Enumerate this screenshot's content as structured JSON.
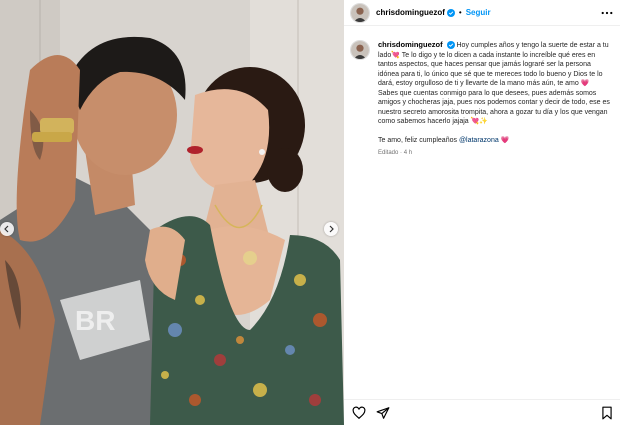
{
  "post": {
    "username": "chrisdominguezof",
    "separator": "•",
    "follow_label": "Seguir",
    "verified_icon": "verified-badge-icon",
    "more_icon": "more-options-icon"
  },
  "caption": {
    "username": "chrisdominguezof",
    "paragraph1": "Hoy cumples años y tengo la suerte de estar a tu lado💘 Te lo digo y te lo dicen a cada instante lo increíble qué eres en tantos aspectos, que haces pensar que jamás lograré ser la persona idónea para ti, lo único que sé que te mereces todo lo bueno y Dios te lo dará, estoy orgulloso de ti y llevarte de la mano más aún, te amo 💗",
    "paragraph2": "Sabes que cuentas conmigo para lo que desees, pues además somos amigos y chocheras jaja, pues nos podemos contar y decir de todo, ese es nuestro secreto amorosita trompita, ahora a gozar tu día y los que vengan como sabemos hacerlo jajaja 💘✨",
    "closing_text": "Te amo, feliz cumpleaños ",
    "mention": "@latarazona",
    "closing_emoji": "💗",
    "edited_label": "Editado",
    "time_sep": "·",
    "time_ago": "4 h"
  },
  "actions": {
    "like_icon": "heart-icon",
    "share_icon": "share-icon",
    "save_icon": "bookmark-icon"
  },
  "colors": {
    "accent": "#0095f6",
    "verified": "#0095f6",
    "mention": "#00376b"
  }
}
